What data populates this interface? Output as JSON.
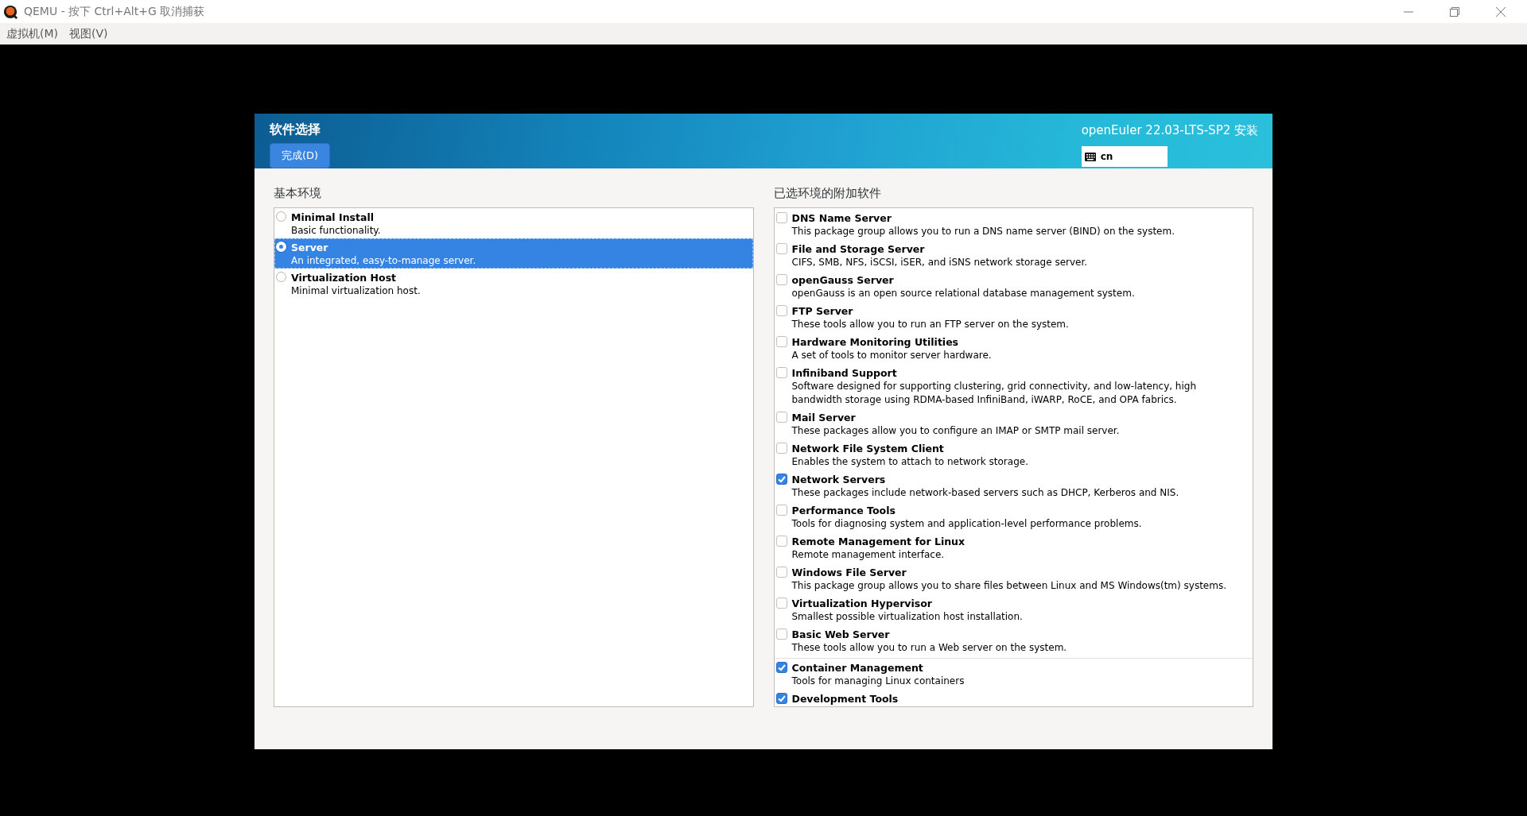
{
  "window": {
    "title": "QEMU - 按下 Ctrl+Alt+G 取消捕获"
  },
  "menu": [
    "虚拟机(M)",
    "视图(V)"
  ],
  "installer": {
    "title": "软件选择",
    "done_button": "完成(D)",
    "product": "openEuler 22.03-LTS-SP2 安装",
    "keyboard": "cn"
  },
  "base_environment": {
    "heading": "基本环境",
    "items": [
      {
        "name": "Minimal Install",
        "description": "Basic functionality.",
        "selected": false
      },
      {
        "name": "Server",
        "description": "An integrated, easy-to-manage server.",
        "selected": true
      },
      {
        "name": "Virtualization Host",
        "description": "Minimal virtualization host.",
        "selected": false
      }
    ]
  },
  "addons": {
    "heading": "已选环境的附加软件",
    "items": [
      {
        "name": "DNS Name Server",
        "description": "This package group allows you to run a DNS name server (BIND) on the system.",
        "checked": false,
        "separator_before": false
      },
      {
        "name": "File and Storage Server",
        "description": "CIFS, SMB, NFS, iSCSI, iSER, and iSNS network storage server.",
        "checked": false,
        "separator_before": false
      },
      {
        "name": "openGauss Server",
        "description": "openGauss is an open source relational database management system.",
        "checked": false,
        "separator_before": false
      },
      {
        "name": "FTP Server",
        "description": "These tools allow you to run an FTP server on the system.",
        "checked": false,
        "separator_before": false
      },
      {
        "name": "Hardware Monitoring Utilities",
        "description": "A set of tools to monitor server hardware.",
        "checked": false,
        "separator_before": false
      },
      {
        "name": "Infiniband Support",
        "description": "Software designed for supporting clustering, grid connectivity, and low-latency, high bandwidth storage using RDMA-based InfiniBand, iWARP, RoCE, and OPA fabrics.",
        "checked": false,
        "separator_before": false
      },
      {
        "name": "Mail Server",
        "description": "These packages allow you to configure an IMAP or SMTP mail server.",
        "checked": false,
        "separator_before": false
      },
      {
        "name": "Network File System Client",
        "description": "Enables the system to attach to network storage.",
        "checked": false,
        "separator_before": false
      },
      {
        "name": "Network Servers",
        "description": "These packages include network-based servers such as DHCP, Kerberos and NIS.",
        "checked": true,
        "separator_before": false
      },
      {
        "name": "Performance Tools",
        "description": "Tools for diagnosing system and application-level performance problems.",
        "checked": false,
        "separator_before": false
      },
      {
        "name": "Remote Management for Linux",
        "description": "Remote management interface.",
        "checked": false,
        "separator_before": false
      },
      {
        "name": "Windows File Server",
        "description": "This package group allows you to share files between Linux and MS Windows(tm) systems.",
        "checked": false,
        "separator_before": false
      },
      {
        "name": "Virtualization Hypervisor",
        "description": "Smallest possible virtualization host installation.",
        "checked": false,
        "separator_before": false
      },
      {
        "name": "Basic Web Server",
        "description": "These tools allow you to run a Web server on the system.",
        "checked": false,
        "separator_before": false
      },
      {
        "name": "Container Management",
        "description": "Tools for managing Linux containers",
        "checked": true,
        "separator_before": true
      },
      {
        "name": "Development Tools",
        "checked": true,
        "separator_before": false
      }
    ]
  }
}
